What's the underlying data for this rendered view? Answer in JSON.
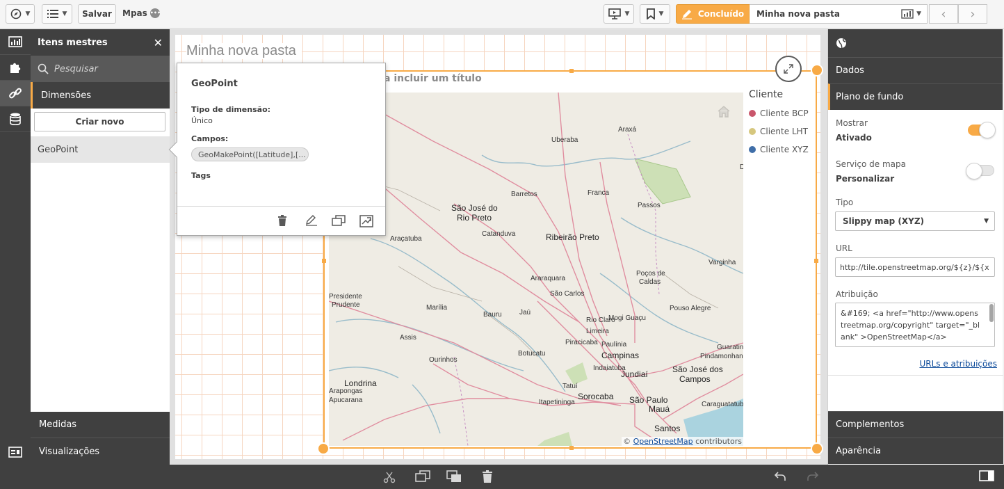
{
  "toolbar": {
    "save_label": "Salvar",
    "app_name": "Mpas",
    "app_name_badge": "•••",
    "done_label": "Concluído",
    "sheet_name": "Minha nova pasta"
  },
  "master_items": {
    "header": "Itens mestres",
    "search_placeholder": "Pesquisar",
    "dimensions_label": "Dimensões",
    "create_new_label": "Criar novo",
    "items": [
      "GeoPoint"
    ],
    "measures_label": "Medidas",
    "visualizations_label": "Visualizações"
  },
  "canvas": {
    "sheet_title": "Minha nova pasta",
    "viz_title_hint": "a incluir um título",
    "attribution_prefix": "©",
    "attribution_link": "OpenStreetMap",
    "attribution_suffix": "contributors",
    "legend": {
      "title": "Cliente",
      "items": [
        {
          "label": "Cliente BCP",
          "color": "#c9566b"
        },
        {
          "label": "Cliente LHT",
          "color": "#d6c77e"
        },
        {
          "label": "Cliente XYZ",
          "color": "#3f6ea8"
        }
      ]
    },
    "map_labels": [
      "Araxá",
      "Uberaba",
      "Barretos",
      "Franca",
      "Passos",
      "São José do",
      "Rio Preto",
      "Catanduva",
      "Ribeirão Preto",
      "Araçatuba",
      "Araraquara",
      "São Carlos",
      "Poços de",
      "Caldas",
      "Varginha",
      "Presidente",
      "Prudente",
      "Marília",
      "Bauru",
      "Jaú",
      "Rio Claro",
      "Mogi Guaçu",
      "Pouso Alegre",
      "Limeira",
      "Assis",
      "Piracicaba",
      "Paulínia",
      "Guaratin",
      "Pindamonhanga",
      "Ourinhos",
      "Botucatu",
      "Campinas",
      "Indaiatuba",
      "Jundiaí",
      "São José dos",
      "Campos",
      "Londrina",
      "Arapongas",
      "Apucarana",
      "Tatuí",
      "Sorocaba",
      "São Paulo",
      "Mauá",
      "Caraguatatub",
      "Itapetininga",
      "Santos",
      "D"
    ]
  },
  "popover": {
    "title": "GeoPoint",
    "dim_type_label": "Tipo de dimensão:",
    "dim_type_value": "Único",
    "fields_label": "Campos:",
    "field_chip": "GeoMakePoint([Latitude],[...",
    "tags_label": "Tags"
  },
  "properties": {
    "data_label": "Dados",
    "background_label": "Plano de fundo",
    "show_label": "Mostrar",
    "show_value": "Ativado",
    "show_toggle_on": true,
    "map_service_label": "Serviço de mapa",
    "map_service_value": "Personalizar",
    "map_service_toggle_on": false,
    "type_label": "Tipo",
    "type_value": "Slippy map (XYZ)",
    "url_label": "URL",
    "url_value": "http://tile.openstreetmap.org/${z}/${x",
    "attribution_label": "Atribuição",
    "attribution_value": "&#169; <a href=\"http://www.openstreetmap.org/copyright\" target=\"_blank\" >OpenStreetMap</a>",
    "urls_link": "URLs e atribuições",
    "addons_label": "Complementos",
    "appearance_label": "Aparência"
  },
  "colors": {
    "accent": "#f8aa46",
    "dark_panel": "#404040",
    "link": "#0c4a9a"
  }
}
